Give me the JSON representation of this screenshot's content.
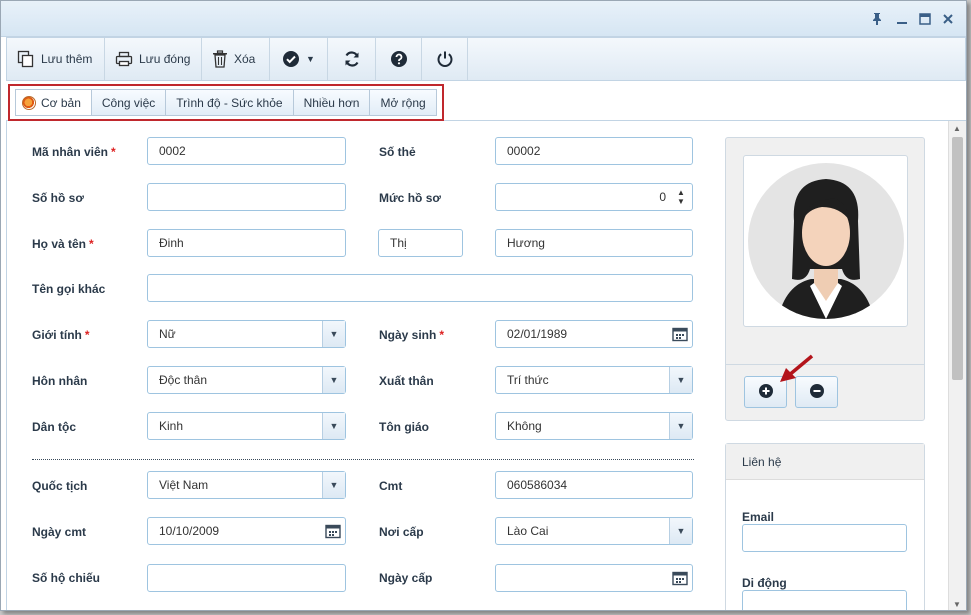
{
  "window": {
    "controls": [
      "pin-icon",
      "minimize-icon",
      "maximize-icon",
      "close-icon"
    ]
  },
  "toolbar": {
    "save_add_label": "Lưu thêm",
    "save_close_label": "Lưu đóng",
    "delete_label": "Xóa"
  },
  "tabs": [
    "Cơ bản",
    "Công việc",
    "Trình độ - Sức khỏe",
    "Nhiều hơn",
    "Mở rộng"
  ],
  "form": {
    "employee_code_label": "Mã nhân viên",
    "employee_code_value": "0002",
    "card_no_label": "Số thẻ",
    "card_no_value": "00002",
    "file_no_label": "Số hồ sơ",
    "file_no_value": "",
    "file_level_label": "Mức hồ sơ",
    "file_level_value": "0",
    "fullname_label": "Họ và tên",
    "last_name": "Đinh",
    "middle_name": "Thị",
    "first_name": "Hương",
    "other_name_label": "Tên gọi khác",
    "other_name_value": "",
    "gender_label": "Giới tính",
    "gender_value": "Nữ",
    "birthdate_label": "Ngày sinh",
    "birthdate_value": "02/01/1989",
    "marital_label": "Hôn nhân",
    "marital_value": "Độc thân",
    "background_label": "Xuất thân",
    "background_value": "Trí thức",
    "ethnicity_label": "Dân tộc",
    "ethnicity_value": "Kinh",
    "religion_label": "Tôn giáo",
    "religion_value": "Không",
    "nationality_label": "Quốc tịch",
    "nationality_value": "Việt Nam",
    "id_label": "Cmt",
    "id_value": "060586034",
    "id_date_label": "Ngày cmt",
    "id_date_value": "10/10/2009",
    "id_place_label": "Nơi cấp",
    "id_place_value": "Lào Cai",
    "passport_label": "Số hộ chiếu",
    "passport_value": "",
    "issue_date_label": "Ngày cấp",
    "issue_date_value": "",
    "required_mark": "*"
  },
  "contact": {
    "header": "Liên hệ",
    "email_label": "Email",
    "email_value": "",
    "mobile_label": "Di động",
    "mobile_value": ""
  },
  "colors": {
    "accent": "#3a6ea5",
    "highlight_box": "#c0282d",
    "field_border": "#9ec4e0",
    "required": "#d22222"
  }
}
